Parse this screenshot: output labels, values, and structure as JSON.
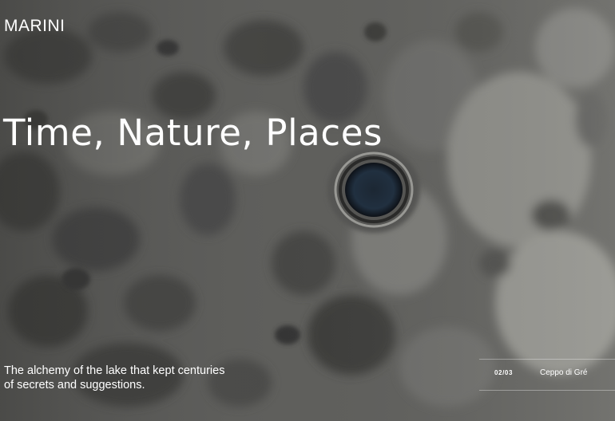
{
  "brand": {
    "name": "MARINI"
  },
  "hero": {
    "title": "Time, Nature, Places",
    "caption": "The alchemy of the lake that kept centuries of secrets and suggestions."
  },
  "slider": {
    "counter": "02/03",
    "current_name": "Ceppo di Gré"
  },
  "colors": {
    "text": "#ffffff",
    "background": "#5d5d5b"
  }
}
